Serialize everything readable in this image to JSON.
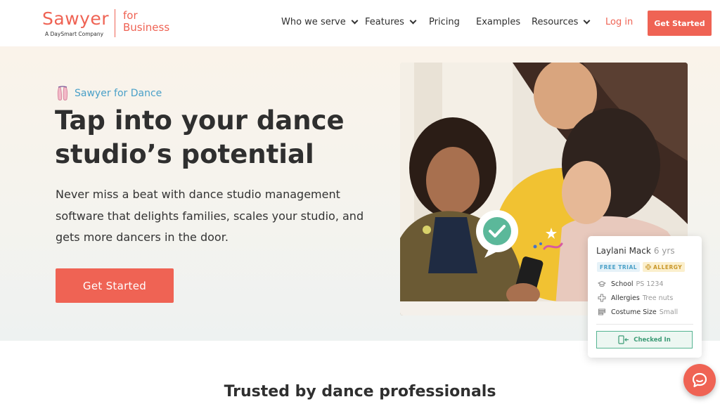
{
  "nav": {
    "logo": "Sawyer",
    "logo_sub": "A DaySmart Company",
    "logo_business": [
      "for",
      "Business"
    ],
    "items": [
      {
        "label": "Who we serve",
        "dropdown": true
      },
      {
        "label": "Features",
        "dropdown": true
      },
      {
        "label": "Pricing",
        "dropdown": false
      },
      {
        "label": "Examples",
        "dropdown": false
      },
      {
        "label": "Resources",
        "dropdown": true
      }
    ],
    "login": "Log in",
    "cta": "Get Started"
  },
  "hero": {
    "eyebrow": "Sawyer for Dance",
    "headline": "Tap into your dance studio’s potential",
    "subtitle": "Never miss a beat with dance studio management software that delights families, scales your studio, and gets more dancers in the door.",
    "cta": "Get Started"
  },
  "card": {
    "name": "Laylani Mack",
    "age": "6 yrs",
    "badges": [
      "FREE TRIAL",
      "ALLERGY"
    ],
    "rows": [
      {
        "label": "School",
        "value": "PS 1234",
        "icon": "graduation-cap-icon"
      },
      {
        "label": "Allergies",
        "value": "Tree nuts",
        "icon": "medical-cross-icon"
      },
      {
        "label": "Costume Size",
        "value": "Small",
        "icon": "costume-icon"
      }
    ],
    "status": "Checked In"
  },
  "trusted": "Trusted by dance professionals",
  "colors": {
    "brand": "#ef6354",
    "eyebrow": "#4aa0c8",
    "check_green": "#55b491",
    "allergy_bg": "#fbefcd"
  }
}
